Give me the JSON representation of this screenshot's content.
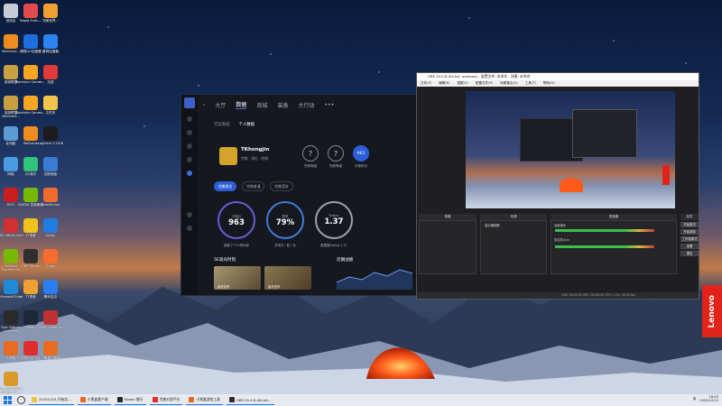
{
  "desktop_icons": [
    {
      "label": "回收站",
      "color": "#c8ccd4"
    },
    {
      "label": "Rapid Endu...",
      "color": "#e24b4b"
    },
    {
      "label": "完美世界...",
      "color": "#f0a030"
    },
    {
      "label": "WeGame...",
      "color": "#f08c1e"
    },
    {
      "label": "網易UU加速器",
      "color": "#1e6ee0"
    },
    {
      "label": "雷神加速器",
      "color": "#2a83f0"
    },
    {
      "label": "英雄联盟",
      "color": "#c8a042"
    },
    {
      "label": "Rockstar Games...",
      "color": "#f5a623"
    },
    {
      "label": "迅游",
      "color": "#e03a3a"
    },
    {
      "label": "英雄联盟 WeGame...",
      "color": "#c8a042"
    },
    {
      "label": "Rockstar Games...",
      "color": "#f5a623"
    },
    {
      "label": "文件夹",
      "color": "#f3c54a"
    },
    {
      "label": "此电脑",
      "color": "#5b9bd5"
    },
    {
      "label": "WeGame",
      "color": "#f08c1e"
    },
    {
      "label": "Logitech G HUB",
      "color": "#1c1c1c"
    },
    {
      "label": "网络",
      "color": "#4a9ae0"
    },
    {
      "label": "QQ音乐",
      "color": "#31c27c"
    },
    {
      "label": "控制面板",
      "color": "#3a7bd5"
    },
    {
      "label": "ROG",
      "color": "#c81e1e"
    },
    {
      "label": "NVIDIA 控制面板",
      "color": "#76b900"
    },
    {
      "label": "SteelSeries",
      "color": "#ef6c2d"
    },
    {
      "label": "MSI Afterburner",
      "color": "#d13030"
    },
    {
      "label": "YY语音",
      "color": "#f2c21c"
    },
    {
      "label": "Uplay",
      "color": "#1f7de0"
    },
    {
      "label": "GeForce Experience",
      "color": "#76b900"
    },
    {
      "label": "OBS Studio",
      "color": "#302e31"
    },
    {
      "label": "Origin",
      "color": "#f56c2d"
    },
    {
      "label": "Microsoft Edge",
      "color": "#1f8ad6"
    },
    {
      "label": "TT语音",
      "color": "#f0a030"
    },
    {
      "label": "腾讯会议",
      "color": "#2a7ef0"
    },
    {
      "label": "Epic Games Launcher",
      "color": "#2a2a2a"
    },
    {
      "label": "Steam",
      "color": "#1b2838"
    },
    {
      "label": "Apex Legends",
      "color": "#c03030"
    },
    {
      "label": "小黑盒",
      "color": "#e86b1f"
    },
    {
      "label": "完美对战平台",
      "color": "#e02d2d"
    },
    {
      "label": "小黑盒加速器",
      "color": "#e86b1f"
    },
    {
      "label": "Counter-Strike Global Off...",
      "color": "#d99a2b"
    }
  ],
  "game_app": {
    "nav": [
      "大厅",
      "数据",
      "商城",
      "装备",
      "大行动",
      "•••"
    ],
    "subtabs": [
      "完美数据",
      "个人数据"
    ],
    "player_name": "TKhongjin",
    "player_meta": "完美 · 排位 · 经典",
    "badges": [
      {
        "glyph": "?",
        "label": "完美等级"
      },
      {
        "glyph": "?",
        "label": "完美等级"
      },
      {
        "glyph": "963",
        "label": "天梯积分"
      }
    ],
    "filters": [
      "完美排位",
      "完美普通",
      "完美竞技"
    ],
    "stats": [
      {
        "title": "天梯分",
        "value": "963",
        "caption": "超越了77%的玩家"
      },
      {
        "title": "胜率",
        "value": "79%",
        "caption": "总场次 / 胜 / 负"
      },
      {
        "title": "Rating",
        "value": "1.37",
        "caption": "数据值Rating 1.37"
      }
    ],
    "clips_title": "5E高光时刻",
    "recent_title": "近期战绩",
    "clips": [
      {
        "label": "高光击杀",
        "color": "#8a7a5a"
      },
      {
        "label": "高光击杀",
        "color": "#7a6a4a"
      }
    ]
  },
  "obs": {
    "title": "OBS 25.0.8 (64-bit, windows) - 配置文件: 未命名 - 场景: 未命名",
    "menu": [
      "文件(F)",
      "编辑(E)",
      "视图(V)",
      "配置文件(P)",
      "场景集合(S)",
      "工具(T)",
      "帮助(H)"
    ],
    "docks": [
      "场景",
      "来源",
      "混音器",
      "转场特效",
      "控件"
    ],
    "source_item": "显示器捕获",
    "mixer_channels": [
      "桌面音频",
      "麦克风/Aux"
    ],
    "controls": [
      "开始推流",
      "开始录制",
      "工作室模式",
      "设置",
      "退出"
    ],
    "status": "LIVE: 00:00:00   REC: 00:00:00   CPU: 1.2%, 30.00 fps"
  },
  "brand": "Lenovo",
  "taskbar": {
    "tasks": [
      {
        "label": "20201024-开始实...",
        "color": "#f0c040"
      },
      {
        "label": "小黑盒客户端",
        "color": "#e86b1f"
      },
      {
        "label": "Steam 聊天",
        "color": "#1b2838"
      },
      {
        "label": "完美对战平台",
        "color": "#e02d2d"
      },
      {
        "label": "小黑盒游戏工具",
        "color": "#e86b1f"
      },
      {
        "label": "OBS 25.0.8 (64-bit...",
        "color": "#302e31"
      }
    ],
    "tray_lang": "英",
    "time": "18:45",
    "date": "2020/10/24"
  }
}
